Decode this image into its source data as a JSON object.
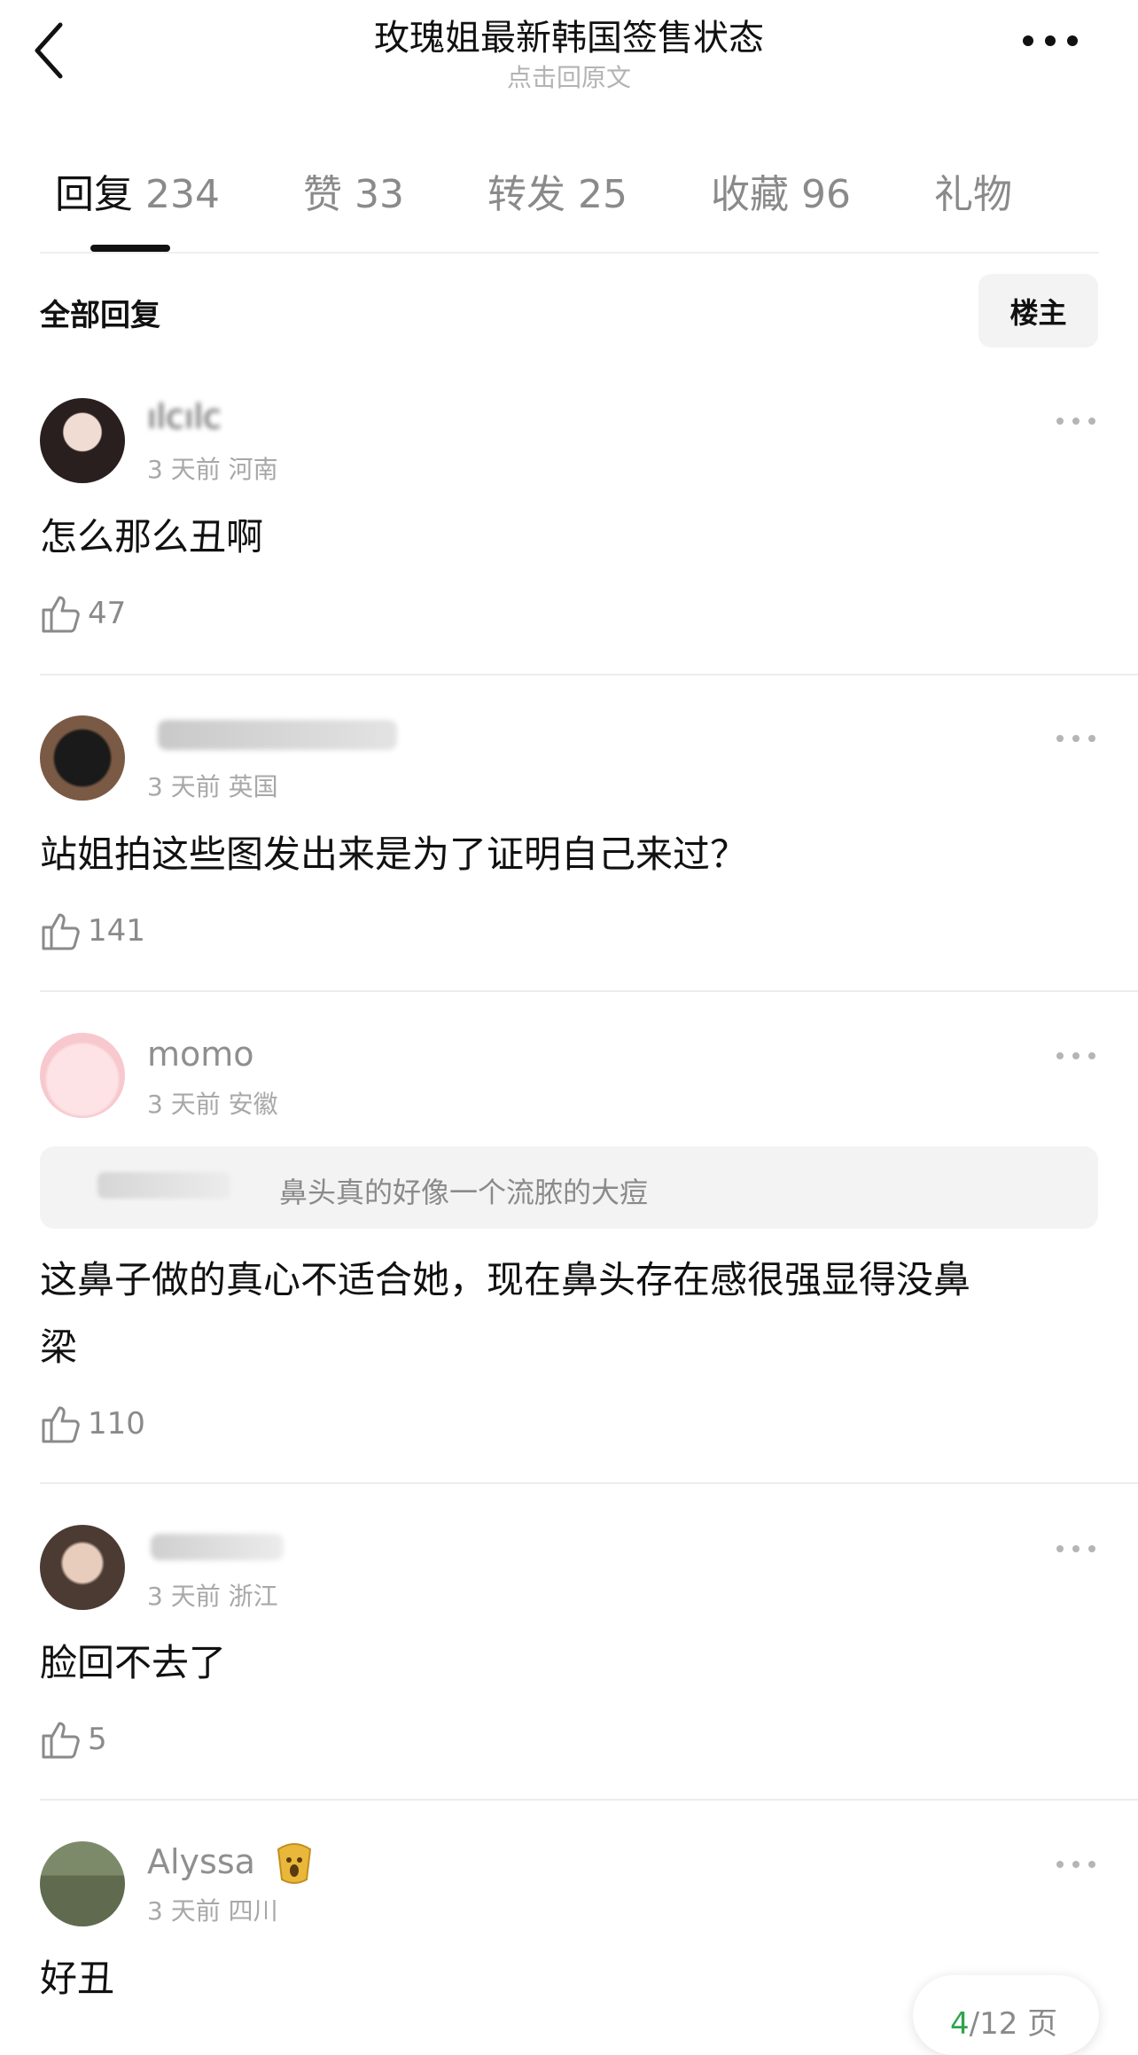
{
  "header": {
    "title": "玫瑰姐最新韩国签售状态",
    "subtitle": "点击回原文"
  },
  "tabs": [
    {
      "label": "回复",
      "count": "234"
    },
    {
      "label": "赞",
      "count": "33"
    },
    {
      "label": "转发",
      "count": "25"
    },
    {
      "label": "收藏",
      "count": "96"
    },
    {
      "label": "礼物",
      "count": ""
    }
  ],
  "filter": {
    "all_replies": "全部回复",
    "op_button": "楼主"
  },
  "comments": [
    {
      "username": "ılcılc",
      "time": "3 天前",
      "location": "河南",
      "content": "怎么那么丑啊",
      "likes": "47"
    },
    {
      "username": "",
      "time": "3 天前",
      "location": "英国",
      "content": "站姐拍这些图发出来是为了证明自己来过？",
      "likes": "141"
    },
    {
      "username": "momo",
      "time": "3 天前",
      "location": "安徽",
      "quote": "鼻头真的好像一个流脓的大痘",
      "content_line1": "这鼻子做的真心不适合她，现在鼻头存在感很强显得没鼻",
      "content_line2": "梁",
      "likes": "110"
    },
    {
      "username": "",
      "time": "3 天前",
      "location": "浙江",
      "content": "脸回不去了",
      "likes": "5"
    },
    {
      "username": "Alyssa",
      "time": "3 天前",
      "location": "四川",
      "content": "好丑"
    }
  ],
  "pager": {
    "current": "4",
    "total": "/12 页"
  },
  "colors": {
    "accent_green": "#2ea44f",
    "text_primary": "#111111",
    "text_secondary": "#8a8a8a"
  }
}
